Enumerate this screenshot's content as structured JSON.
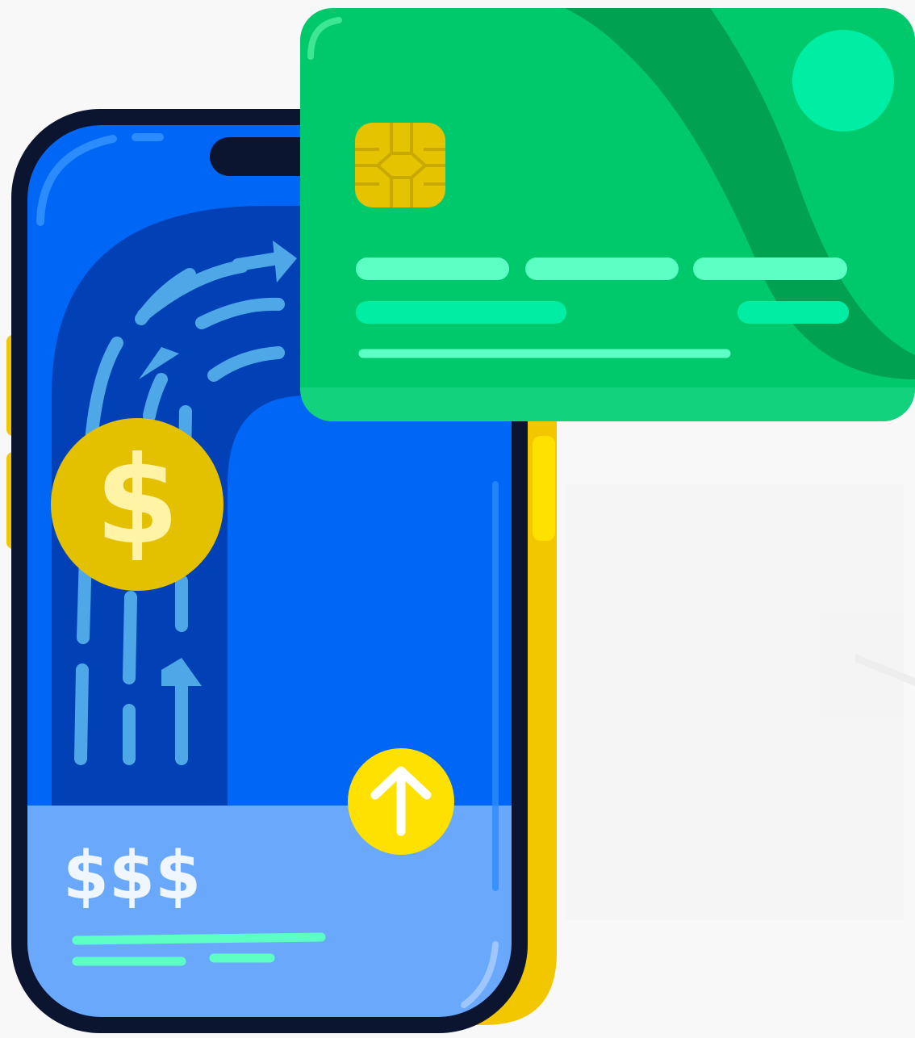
{
  "phone": {
    "balance_label": "$$$",
    "coin_symbol": "$"
  },
  "colors": {
    "phone_body": "#0c1530",
    "phone_screen": "#0066f5",
    "screen_dark": "#0141b5",
    "screen_bottom": "#6aa8fb",
    "phone_side": "#f2c700",
    "coin": "#e3c000",
    "coin_symbol": "#fff3a6",
    "upload_button": "#ffe100",
    "card": "#00c96c",
    "card_stripe": "#00a252",
    "card_lines": "#5cffc4",
    "card_chip": "#e5c300",
    "card_dot": "#00eea3",
    "arrows": "#4ea8e8"
  },
  "icons": {
    "coin": "dollar-coin-icon",
    "upload": "arrow-up-icon",
    "chip": "card-chip-icon"
  }
}
